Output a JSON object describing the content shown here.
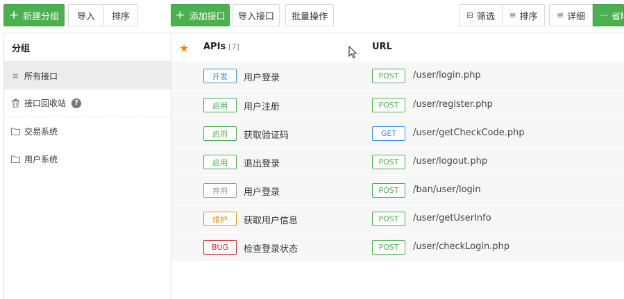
{
  "toolbar": {
    "new_group": "新建分组",
    "import": "导入",
    "sort": "排序",
    "add_api": "添加接口",
    "import_api": "导入接口",
    "batch": "批量操作",
    "filter": "筛选",
    "sort2": "排序",
    "detail": "详细",
    "compact": "省略"
  },
  "sidebar": {
    "title": "分组",
    "items": [
      {
        "label": "所有接口",
        "icon": "list-icon"
      },
      {
        "label": "接口回收站",
        "icon": "trash-icon"
      },
      {
        "label": "交易系统",
        "icon": "folder-icon"
      },
      {
        "label": "用户系统",
        "icon": "folder-icon"
      }
    ]
  },
  "list": {
    "apis_label": "APIs",
    "apis_count": "[7]",
    "url_label": "URL",
    "rows": [
      {
        "status": "开发",
        "status_color": "#3a8ee6",
        "name": "用户登录",
        "method": "POST",
        "method_color": "#4caf50",
        "url": "/user/login.php"
      },
      {
        "status": "启用",
        "status_color": "#4caf50",
        "name": "用户注册",
        "method": "POST",
        "method_color": "#4caf50",
        "url": "/user/register.php"
      },
      {
        "status": "启用",
        "status_color": "#4caf50",
        "name": "获取验证码",
        "method": "GET",
        "method_color": "#3a8ee6",
        "url": "/user/getCheckCode.php"
      },
      {
        "status": "启用",
        "status_color": "#4caf50",
        "name": "退出登录",
        "method": "POST",
        "method_color": "#4caf50",
        "url": "/user/logout.php"
      },
      {
        "status": "弃用",
        "status_color": "#999999",
        "name": "用户登录",
        "method": "POST",
        "method_color": "#4caf50",
        "url": "/ban/user/login"
      },
      {
        "status": "维护",
        "status_color": "#e0932a",
        "name": "获取用户信息",
        "method": "POST",
        "method_color": "#4caf50",
        "url": "/user/getUserInfo"
      },
      {
        "status": "BUG",
        "status_color": "#c62828",
        "name": "检查登录状态",
        "method": "POST",
        "method_color": "#4caf50",
        "url": "/user/checkLogin.php"
      }
    ]
  }
}
